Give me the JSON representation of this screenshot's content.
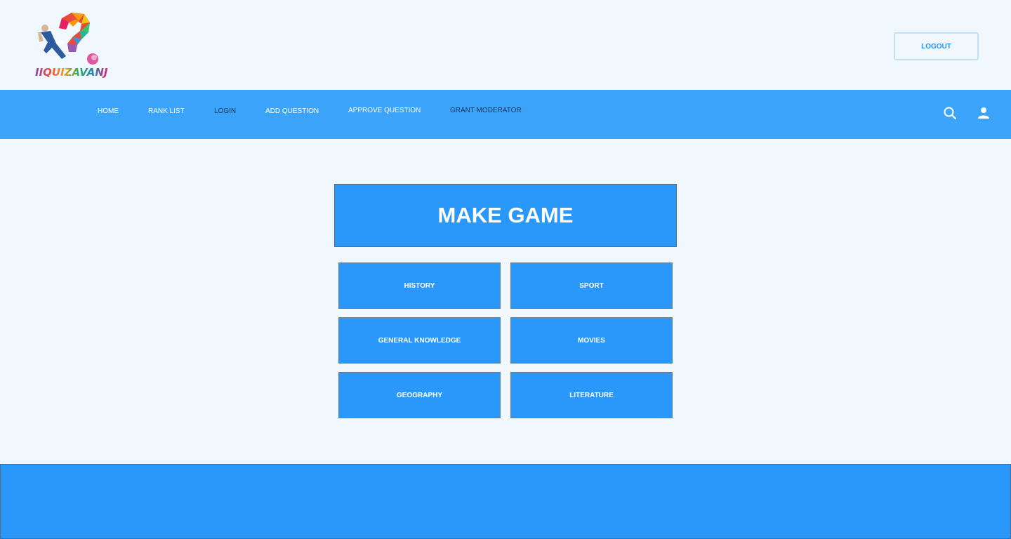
{
  "header": {
    "logo_text": "IIQUIZAVANJE",
    "logout_label": "LOGOUT"
  },
  "nav": {
    "items": [
      {
        "label": "HOME"
      },
      {
        "label": "RANK LIST"
      },
      {
        "label": "LOGIN"
      },
      {
        "label": "ADD QUESTION"
      },
      {
        "label": "APPROVE QUESTION"
      },
      {
        "label": "GRANT MODERATOR"
      }
    ],
    "icons": [
      "search-icon",
      "user-icon"
    ]
  },
  "main": {
    "make_game_label": "MAKE GAME",
    "categories": [
      {
        "label": "HISTORY"
      },
      {
        "label": "SPORT"
      },
      {
        "label": "GENERAL KNOWLEDGE"
      },
      {
        "label": "MOVIES"
      },
      {
        "label": "GEOGRAPHY"
      },
      {
        "label": "LITERATURE"
      }
    ]
  },
  "colors": {
    "background": "#f0f7fd",
    "navbar": "#3ca3fb",
    "button": "#2a97fb",
    "accent": "#2196f3"
  }
}
